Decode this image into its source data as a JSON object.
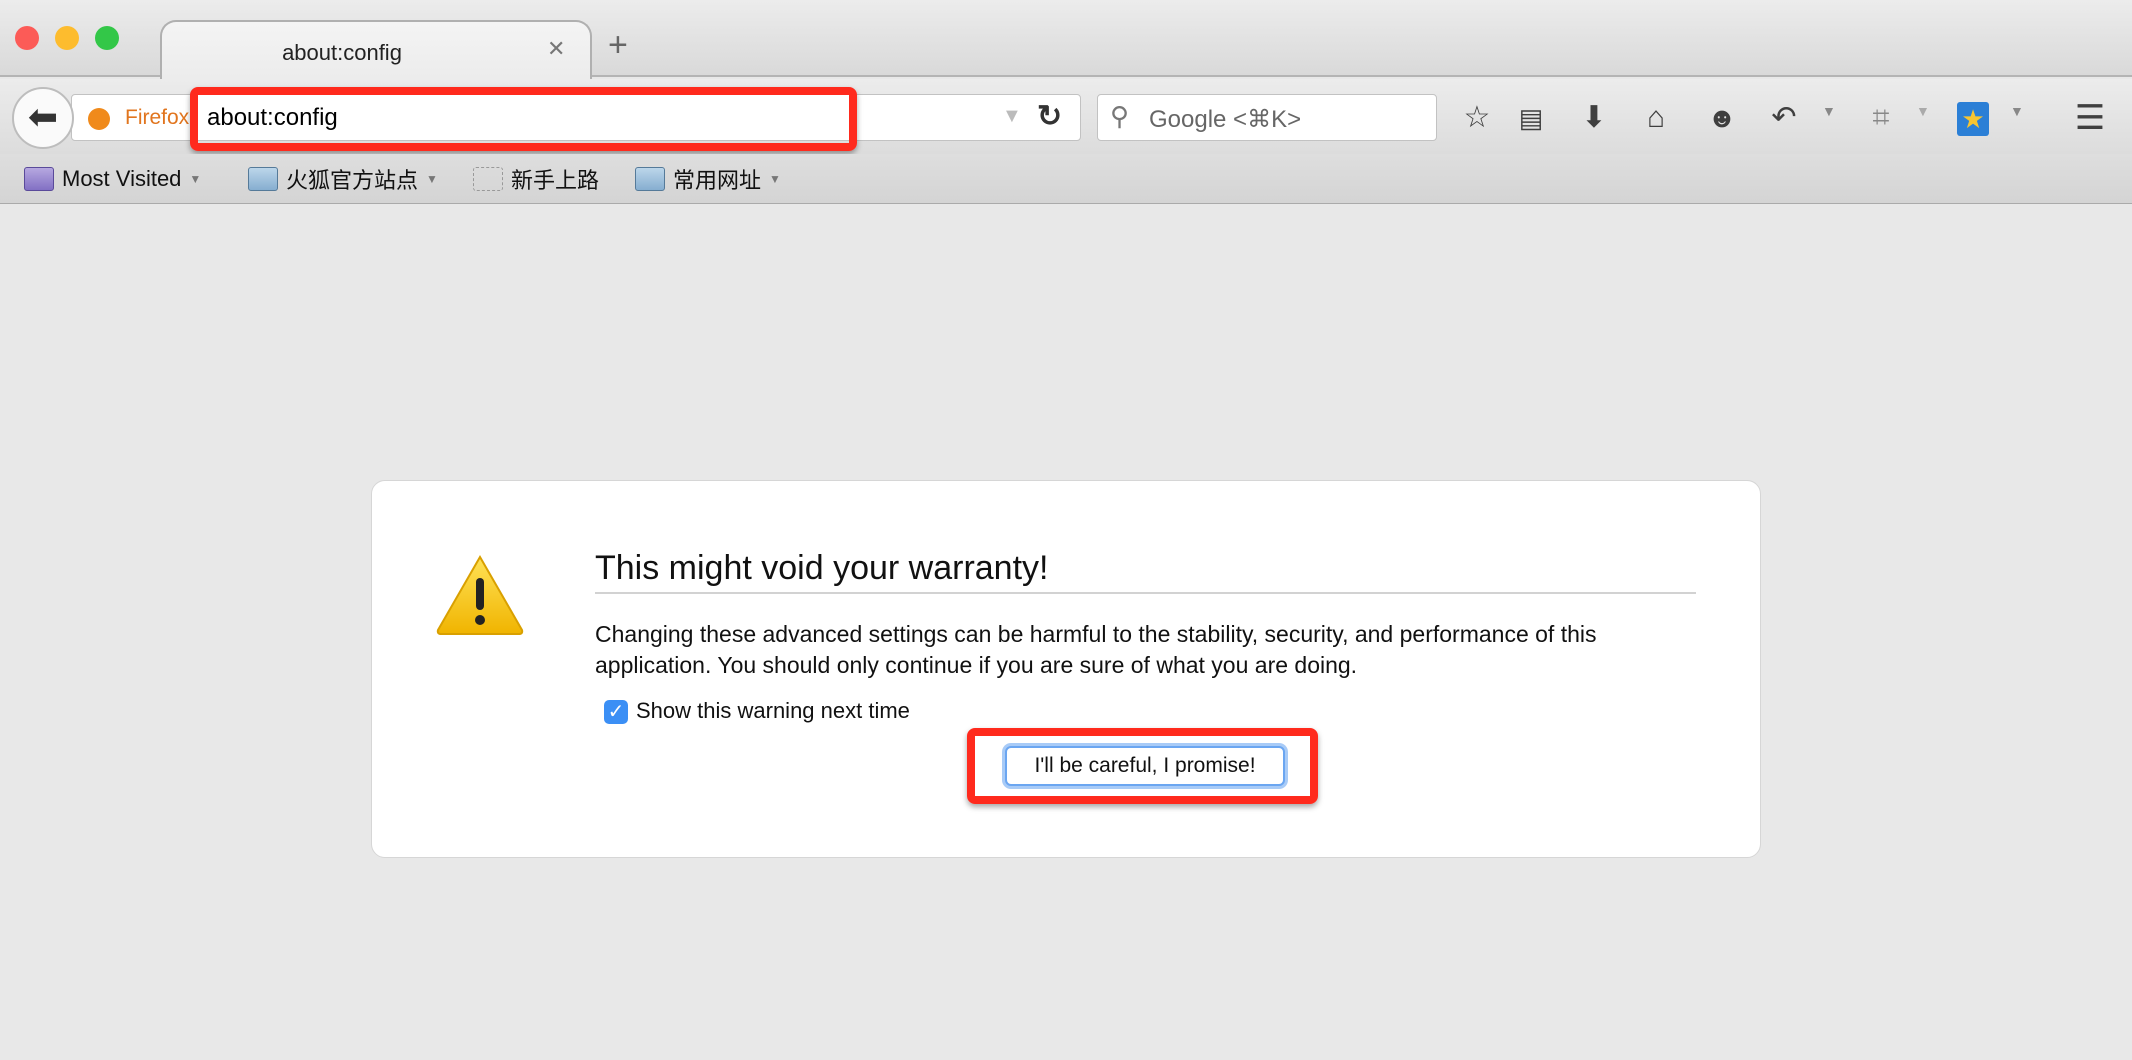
{
  "window": {
    "traffic_lights": {
      "close": "#fc5b57",
      "minimize": "#fdbc2e",
      "zoom": "#33c748"
    }
  },
  "tab": {
    "title": "about:config",
    "close_icon": "close-icon",
    "new_tab_icon": "plus-icon"
  },
  "toolbar": {
    "identity_label": "Firefox",
    "url": "about:config",
    "search_placeholder": "Google <⌘K>",
    "icons": [
      "star-icon",
      "reading-list-icon",
      "download-icon",
      "home-icon",
      "chat-icon",
      "undo-icon",
      "crop-icon",
      "z-star-icon",
      "menu-icon"
    ]
  },
  "bookmarks": [
    {
      "label": "Most Visited",
      "has_dropdown": true
    },
    {
      "label": "火狐官方站点",
      "has_dropdown": true
    },
    {
      "label": "新手上路",
      "has_dropdown": false
    },
    {
      "label": "常用网址",
      "has_dropdown": true
    }
  ],
  "warning": {
    "title": "This might void your warranty!",
    "body": "Changing these advanced settings can be harmful to the stability, security, and performance of this application. You should only continue if you are sure of what you are doing.",
    "checkbox_label": "Show this warning next time",
    "checkbox_checked": true,
    "button_label": "I'll be careful, I promise!"
  },
  "annotation_color": "#ff2a1d"
}
